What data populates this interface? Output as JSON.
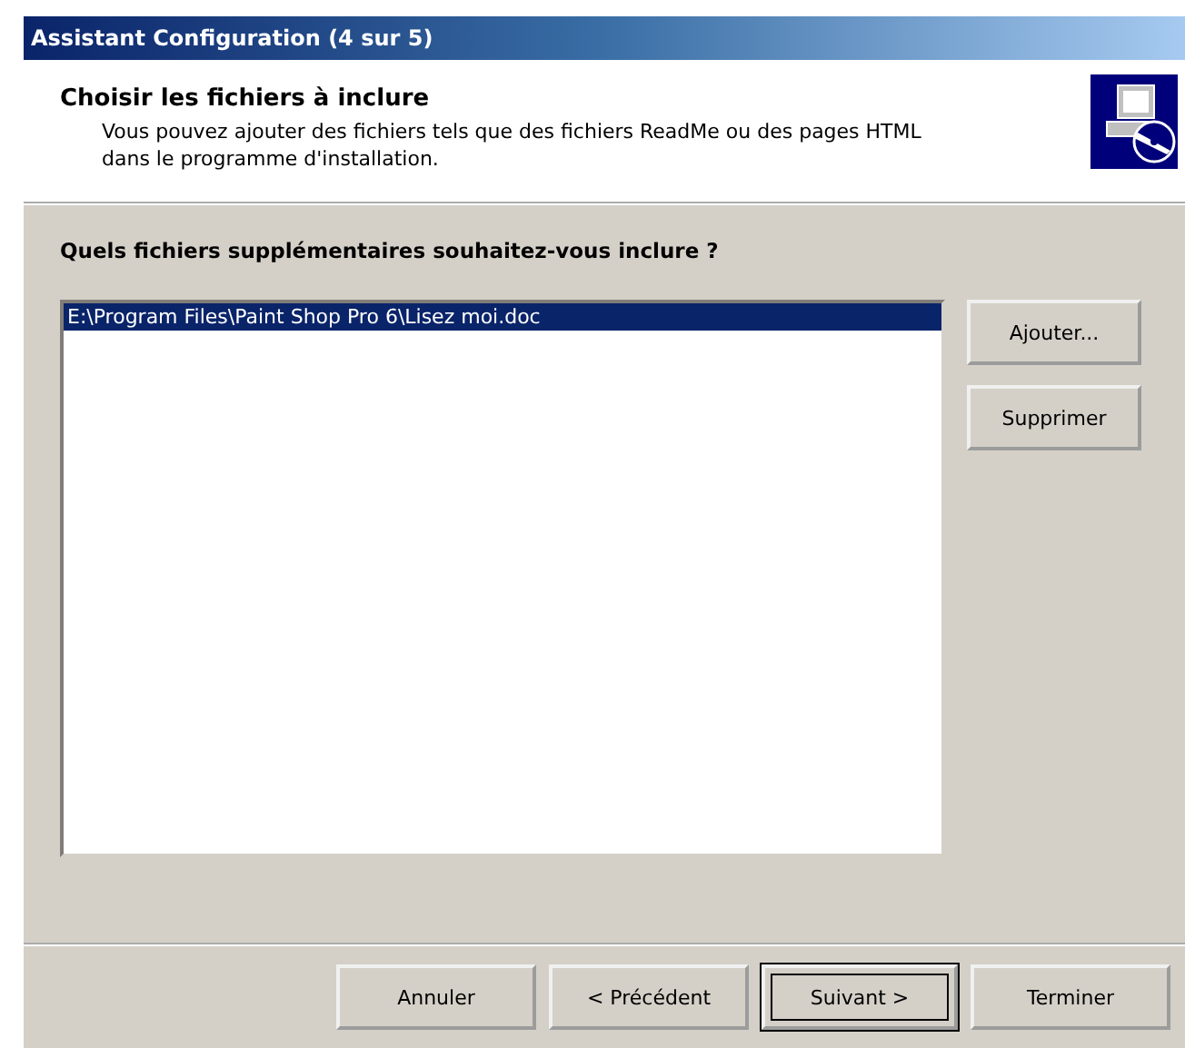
{
  "window": {
    "title": "Assistant Configuration (4 sur 5)"
  },
  "header": {
    "title": "Choisir les fichiers à inclure",
    "description": "Vous pouvez ajouter des fichiers tels que des fichiers ReadMe ou des pages HTML dans le programme d'installation."
  },
  "question": "Quels fichiers supplémentaires souhaitez-vous inclure ?",
  "files": [
    {
      "path": "E:\\Program Files\\Paint Shop Pro 6\\Lisez moi.doc",
      "selected": true
    }
  ],
  "side_buttons": [
    "Ajouter...",
    "Supprimer"
  ],
  "buttons": [
    {
      "label": "Annuler",
      "default": false
    },
    {
      "label": "< Précédent",
      "default": false
    },
    {
      "label": "Suivant >",
      "default": true
    },
    {
      "label": "Terminer",
      "default": false
    }
  ]
}
